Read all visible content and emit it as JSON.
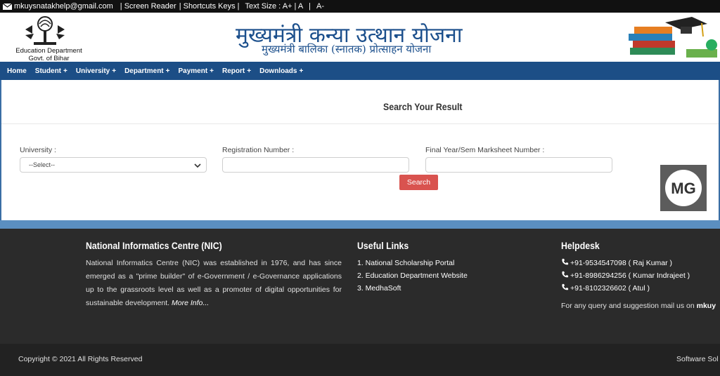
{
  "topbar": {
    "email": "mkuysnatakhelp@gmail.com",
    "screen_reader": "| Screen Reader",
    "shortcuts": "| Shortcuts Keys |",
    "text_size": "Text Size : A+ | A",
    "separator": "|",
    "text_smaller": "A-"
  },
  "header": {
    "dept_line1": "Education Department",
    "dept_line2": "Govt. of Bihar",
    "title": "मुख्यमंत्री कन्या उत्थान योजना",
    "subtitle": "मुख्यमंत्री बालिका (स्नातक) प्रोत्साहन योजना"
  },
  "nav": {
    "items": [
      {
        "label": "Home",
        "plus": ""
      },
      {
        "label": "Student",
        "plus": "+"
      },
      {
        "label": "University",
        "plus": "+"
      },
      {
        "label": "Department",
        "plus": "+"
      },
      {
        "label": "Payment",
        "plus": "+"
      },
      {
        "label": "Report",
        "plus": "+"
      },
      {
        "label": "Downloads",
        "plus": "+"
      }
    ]
  },
  "form": {
    "title": "Search Your Result",
    "university_label": "University :",
    "university_selected": "--Select--",
    "registration_label": "Registration Number :",
    "registration_value": "",
    "marksheet_label": "Final Year/Sem Marksheet Number :",
    "marksheet_value": "",
    "search_button": "Search"
  },
  "footer": {
    "nic_title": "National Informatics Centre (NIC)",
    "nic_text": "National Informatics Centre (NIC) was established in 1976, and has since emerged as a \"prime builder\" of e-Government / e-Governance applications up to the grassroots level as well as a promoter of digital opportunities for sustainable development.",
    "nic_more": "More Info...",
    "links_title": "Useful Links",
    "links": [
      "1. National Scholarship Portal",
      "2. Education Department Website",
      "3. MedhaSoft"
    ],
    "helpdesk_title": "Helpdesk",
    "helpdesk": [
      "+91-9534547098 ( Raj Kumar )",
      "+91-8986294256 ( Kumar Indrajeet )",
      "+91-8102326602 ( Atul )"
    ],
    "query_text": "For any query and suggestion mail us on",
    "query_mail": "mkuy"
  },
  "bottom": {
    "copyright": "Copyright © 2021 All Rights Reserved",
    "software": "Software Sol"
  },
  "colors": {
    "nav": "#1c4e86",
    "title": "#1b4f8c",
    "button": "#d9534f",
    "footer": "#2b2b2b"
  }
}
